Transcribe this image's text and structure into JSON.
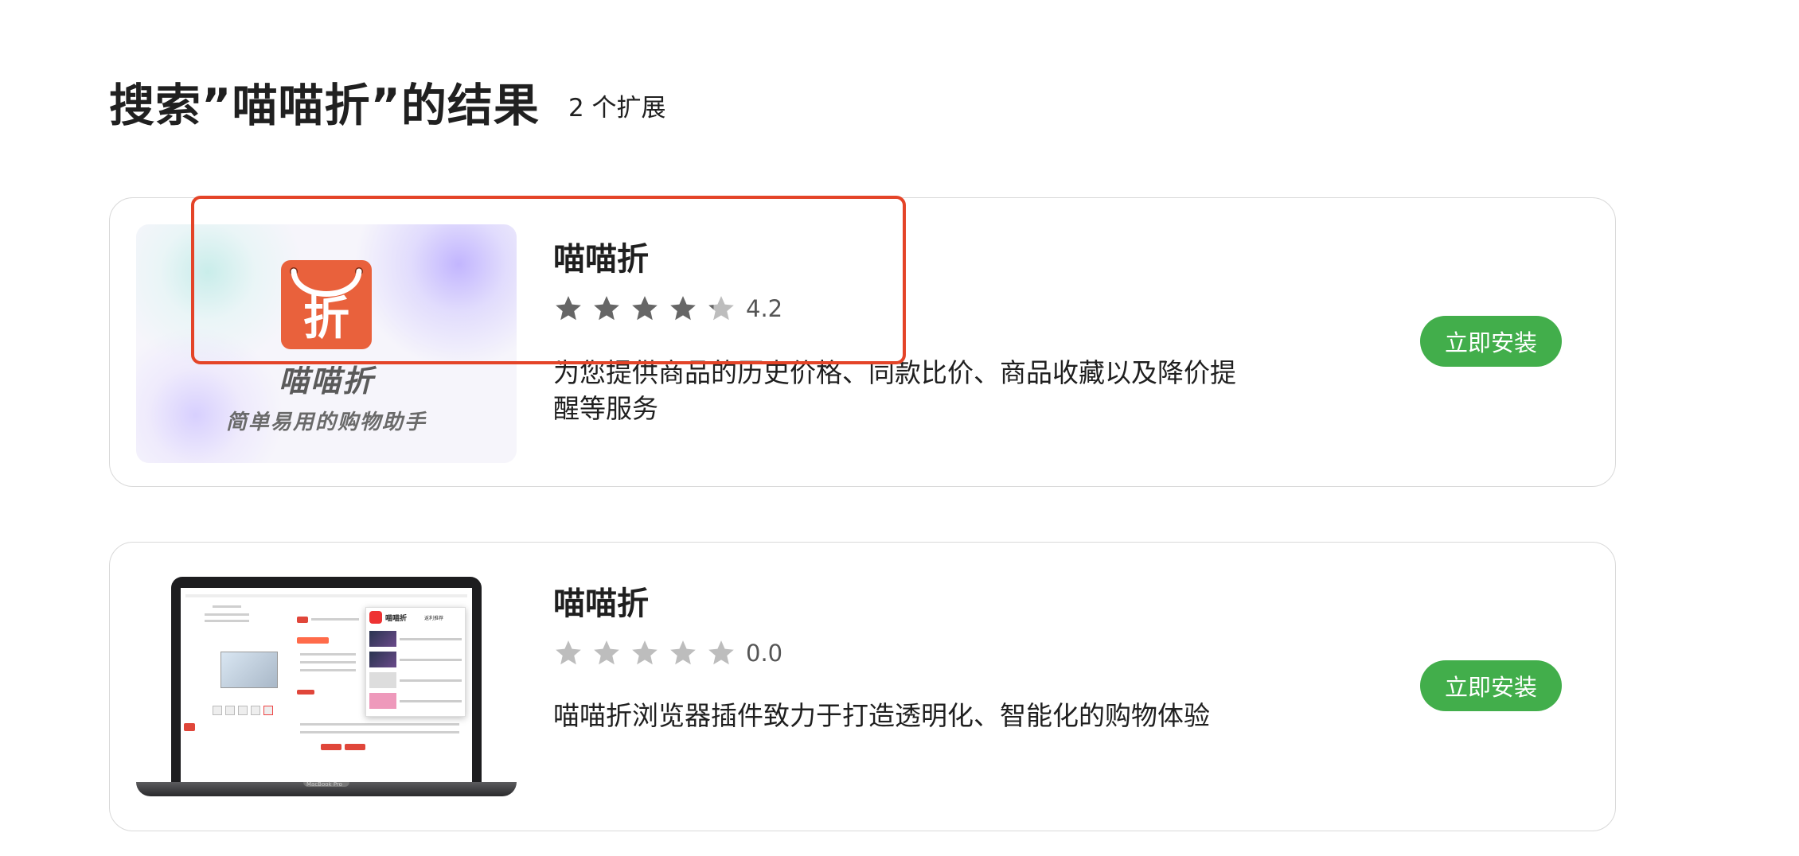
{
  "header": {
    "title": "搜索”喵喵折”的结果",
    "count_label": "2 个扩展"
  },
  "results": [
    {
      "name": "喵喵折",
      "rating": 4.2,
      "rating_label": "4.2",
      "description": "为您提供商品的历史价格、同款比价、商品收藏以及降价提醒等服务",
      "install_label": "立即安装",
      "thumbnail": {
        "logo_char": "折",
        "title": "喵喵折",
        "subtitle": "简单易用的购物助手"
      }
    },
    {
      "name": "喵喵折",
      "rating": 0.0,
      "rating_label": "0.0",
      "description": "喵喵折浏览器插件致力于打造透明化、智能化的购物体验",
      "install_label": "立即安装",
      "thumbnail": {
        "popup_title": "喵喵折",
        "popup_tag": "返利推荐",
        "laptop_brand": "MacBook Pro"
      }
    }
  ],
  "colors": {
    "install_button": "#42ae4b",
    "highlight_border": "#e44428",
    "logo_background": "#e9613c",
    "star_filled": "#666666",
    "star_empty": "#bdbdbd"
  },
  "icons": {
    "star": "star-icon",
    "logo": "shopping-bag-icon"
  }
}
